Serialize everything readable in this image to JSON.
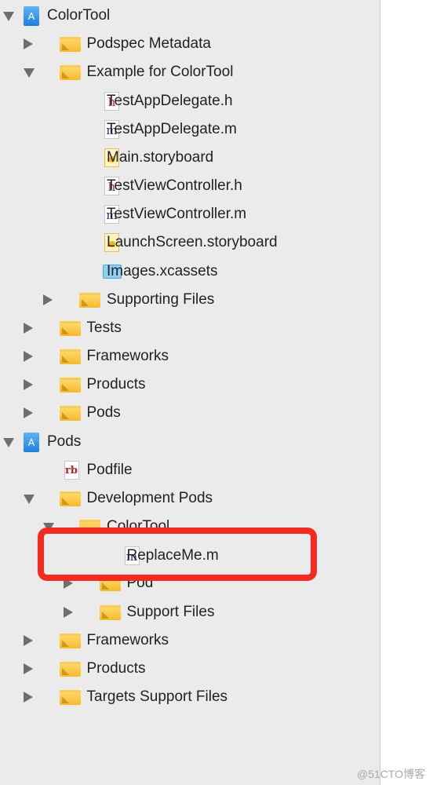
{
  "navigator": {
    "items": [
      {
        "label": "ColorTool",
        "level": 0,
        "icon": "project-icon",
        "state": "expanded"
      },
      {
        "label": "Podspec Metadata",
        "level": 1,
        "icon": "folder-icon",
        "state": "collapsed"
      },
      {
        "label": "Example for ColorTool",
        "level": 1,
        "icon": "folder-icon",
        "state": "expanded"
      },
      {
        "label": "TestAppDelegate.h",
        "level": 2,
        "icon": "header-file-icon"
      },
      {
        "label": "TestAppDelegate.m",
        "level": 2,
        "icon": "objc-file-icon"
      },
      {
        "label": "Main.storyboard",
        "level": 2,
        "icon": "storyboard-icon"
      },
      {
        "label": "TestViewController.h",
        "level": 2,
        "icon": "header-file-icon"
      },
      {
        "label": "TestViewController.m",
        "level": 2,
        "icon": "objc-file-icon"
      },
      {
        "label": "LaunchScreen.storyboard",
        "level": 2,
        "icon": "storyboard-icon"
      },
      {
        "label": "Images.xcassets",
        "level": 2,
        "icon": "asset-catalog-icon"
      },
      {
        "label": "Supporting Files",
        "level": 2,
        "icon": "folder-icon",
        "state": "collapsed"
      },
      {
        "label": "Tests",
        "level": 1,
        "icon": "folder-icon",
        "state": "collapsed"
      },
      {
        "label": "Frameworks",
        "level": 1,
        "icon": "folder-icon",
        "state": "collapsed"
      },
      {
        "label": "Products",
        "level": 1,
        "icon": "folder-icon",
        "state": "collapsed"
      },
      {
        "label": "Pods",
        "level": 1,
        "icon": "folder-icon",
        "state": "collapsed"
      },
      {
        "label": "Pods",
        "level": 0,
        "icon": "project-icon",
        "state": "expanded"
      },
      {
        "label": "Podfile",
        "level": 1,
        "icon": "ruby-file-icon"
      },
      {
        "label": "Development Pods",
        "level": 1,
        "icon": "folder-icon",
        "state": "expanded"
      },
      {
        "label": "ColorTool",
        "level": 2,
        "icon": "folder-icon",
        "state": "expanded"
      },
      {
        "label": "ReplaceMe.m",
        "level": 3,
        "icon": "objc-file-icon",
        "highlighted": true
      },
      {
        "label": "Pod",
        "level": 3,
        "icon": "folder-icon",
        "state": "collapsed"
      },
      {
        "label": "Support Files",
        "level": 3,
        "icon": "folder-icon",
        "state": "collapsed"
      },
      {
        "label": "Frameworks",
        "level": 1,
        "icon": "folder-icon",
        "state": "collapsed"
      },
      {
        "label": "Products",
        "level": 1,
        "icon": "folder-icon",
        "state": "collapsed"
      },
      {
        "label": "Targets Support Files",
        "level": 1,
        "icon": "folder-icon",
        "state": "collapsed"
      }
    ]
  },
  "highlight_color": "#f52a1f",
  "watermark": "@51CTO博客"
}
